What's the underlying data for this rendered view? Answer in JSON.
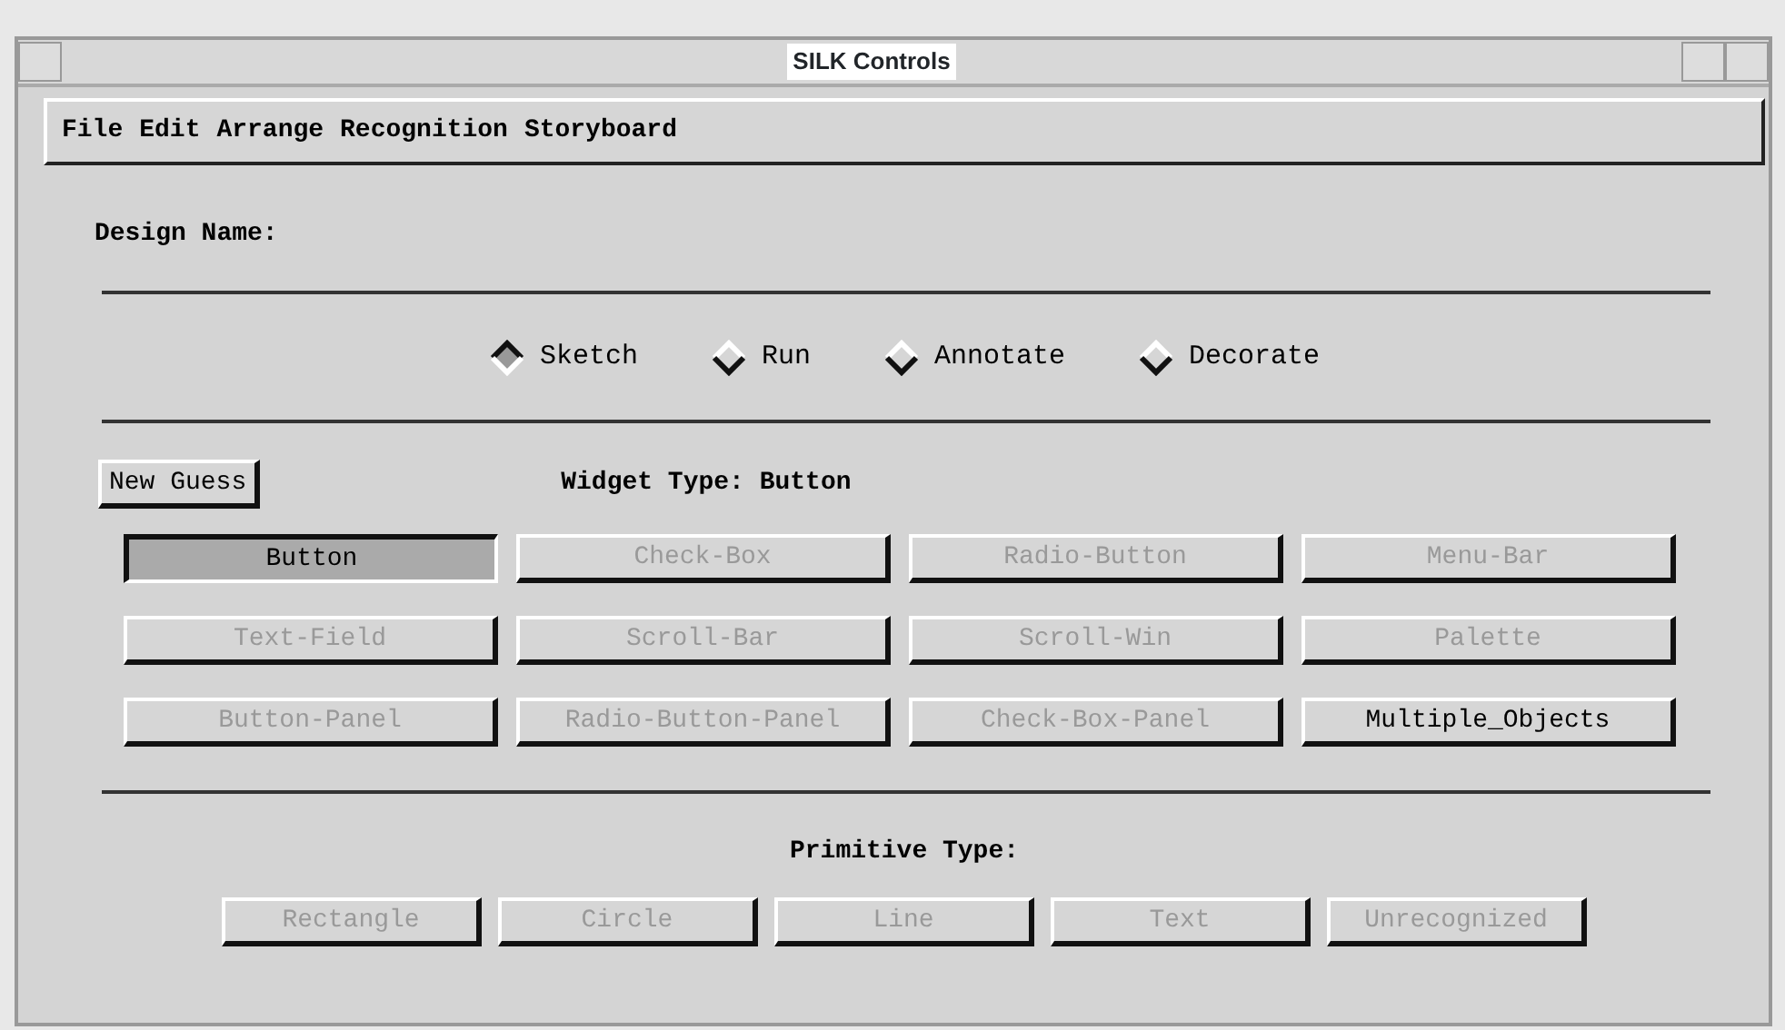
{
  "window": {
    "title": "SILK Controls"
  },
  "menu_bar": [
    "File",
    "Edit",
    "Arrange",
    "Recognition",
    "Storyboard"
  ],
  "design_name": {
    "label": "Design Name:"
  },
  "modes": [
    {
      "label": "Sketch",
      "selected": true
    },
    {
      "label": "Run",
      "selected": false
    },
    {
      "label": "Annotate",
      "selected": false
    },
    {
      "label": "Decorate",
      "selected": false
    }
  ],
  "new_guess_button": "New Guess",
  "widget_type": {
    "label": "Widget Type: Button"
  },
  "widget_buttons": [
    {
      "label": "Button",
      "selected": true,
      "disabled": false
    },
    {
      "label": "Check-Box",
      "selected": false,
      "disabled": true
    },
    {
      "label": "Radio-Button",
      "selected": false,
      "disabled": true
    },
    {
      "label": "Menu-Bar",
      "selected": false,
      "disabled": true
    },
    {
      "label": "Text-Field",
      "selected": false,
      "disabled": true
    },
    {
      "label": "Scroll-Bar",
      "selected": false,
      "disabled": true
    },
    {
      "label": "Scroll-Win",
      "selected": false,
      "disabled": true
    },
    {
      "label": "Palette",
      "selected": false,
      "disabled": true
    },
    {
      "label": "Button-Panel",
      "selected": false,
      "disabled": true
    },
    {
      "label": "Radio-Button-Panel",
      "selected": false,
      "disabled": true
    },
    {
      "label": "Check-Box-Panel",
      "selected": false,
      "disabled": true
    },
    {
      "label": "Multiple_Objects",
      "selected": false,
      "disabled": false
    }
  ],
  "primitive_type": {
    "label": "Primitive Type:"
  },
  "primitive_buttons": [
    {
      "label": "Rectangle",
      "selected": false,
      "disabled": true
    },
    {
      "label": "Circle",
      "selected": false,
      "disabled": true
    },
    {
      "label": "Line",
      "selected": false,
      "disabled": true
    },
    {
      "label": "Text",
      "selected": false,
      "disabled": true
    },
    {
      "label": "Unrecognized",
      "selected": false,
      "disabled": true
    }
  ]
}
